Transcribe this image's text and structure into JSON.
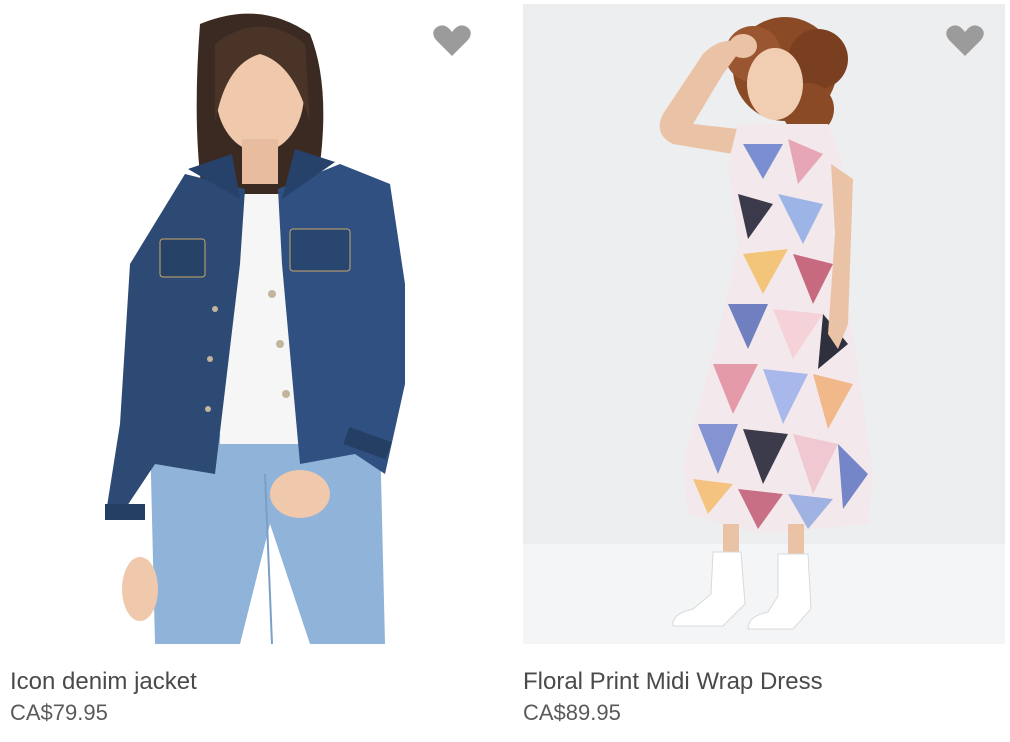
{
  "products": [
    {
      "name": "Icon denim jacket",
      "price": "CA$79.95",
      "image_icon": "denim-jacket-photo",
      "favorite_icon": "heart-icon"
    },
    {
      "name": "Floral Print Midi Wrap Dress",
      "price": "CA$89.95",
      "image_icon": "floral-dress-photo",
      "favorite_icon": "heart-icon"
    }
  ],
  "colors": {
    "text_primary": "#4a4a4a",
    "text_price": "#5a5a5a",
    "heart": "#9b9b9b",
    "denim_dark": "#2c4a73",
    "jeans_light": "#8fb3d9",
    "background_left": "#ffffff",
    "background_right": "#eceef0"
  }
}
